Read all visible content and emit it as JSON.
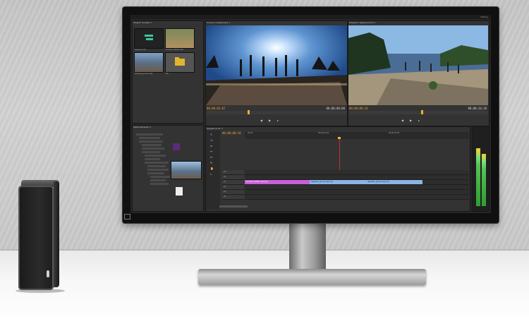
{
  "scene": {
    "description_colors": {
      "wall": "#cdcdcd",
      "desk": "#f4f4f4",
      "drive": "#1e1e1e",
      "bezel": "#101010"
    }
  },
  "app": {
    "workspace_label": "Editing",
    "project_panel": {
      "tab": "Project: Sunset ×",
      "items": [
        {
          "label": "Sequence 01",
          "icon": "sequence-icon"
        },
        {
          "label": "sunset_rooftop.mp4",
          "icon": "clip-thumbnail"
        },
        {
          "label": "lakeside_group.mp4",
          "icon": "clip-thumbnail"
        },
        {
          "label": "Bin",
          "icon": "folder-icon"
        }
      ]
    },
    "source_monitor": {
      "tab": "Source: sunset.mp4 ×",
      "timecode_in": "00;00;03;07",
      "timecode_dur": "00;00;08;00"
    },
    "program_monitor": {
      "tab": "Program: Sequence 01 ×",
      "timecode_in": "00;00;08;10",
      "timecode_dur": "00;00;34;10"
    },
    "media_browser": {
      "tab": "Media Browser ×"
    },
    "timeline": {
      "tab": "Sequence 01 ×",
      "timecode": "00;00;08;10",
      "ruler": [
        "00;00",
        "00;00;16;00",
        "00;00;32;00"
      ],
      "tracks": [
        "V3",
        "V2",
        "V1",
        "A1",
        "A2",
        "A3"
      ],
      "clips": [
        {
          "label": "sunset_rooftop.mp4 [V]",
          "color": "#c760d6"
        },
        {
          "label": "lakeside_group.mp4 [V]",
          "color": "#8bb4e6"
        },
        {
          "label": "lakeside_group.mp4 [V]",
          "color": "#8bb4e6"
        }
      ]
    },
    "audio_meters": {
      "levels": [
        0.82,
        0.74
      ]
    }
  }
}
